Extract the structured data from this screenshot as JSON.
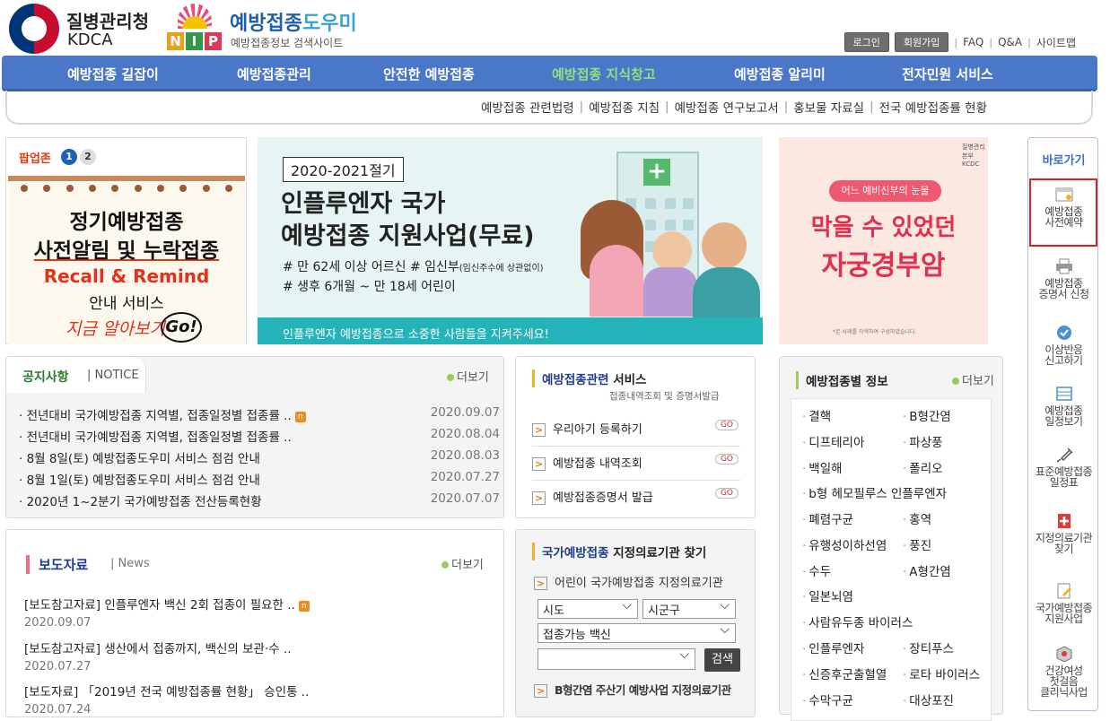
{
  "header": {
    "kdca_name": "질병관리청",
    "kdca_en": "KDCA",
    "nip_title_a": "예방접종",
    "nip_title_b": "도우미",
    "nip_sub": "예방접종정보 검색사이트",
    "nip_letters": [
      "N",
      "I",
      "P"
    ],
    "util": {
      "login": "로그인",
      "join": "회원가입",
      "faq": "FAQ",
      "qa": "Q&A",
      "sitemap": "사이트맵"
    }
  },
  "nav": {
    "items": [
      "예방접종 길잡이",
      "예방접종관리",
      "안전한 예방접종",
      "예방접종 지식창고",
      "예방접종 알리미",
      "전자민원 서비스"
    ],
    "active_index": 3,
    "sub": [
      "예방접종 관련법령",
      "예방접종 지침",
      "예방접종 연구보고서",
      "홍보물 자료실",
      "전국 예방접종률 현황"
    ]
  },
  "popup": {
    "title": "팝업존",
    "num1": "1",
    "num2": "2",
    "line1": "정기예방접종",
    "line2": "사전알림 및 누락접종",
    "line3": "Recall & Remind",
    "line4": "안내 서비스",
    "line5": "지금 알아보기",
    "go": "Go!"
  },
  "flu_banner": {
    "year": "2020-2021절기",
    "title1": "인플루엔자 국가",
    "title2": "예방접종 지원사업(무료)",
    "sub1": "# 만 62세 이상 어르신 # 임신부",
    "sub1_small": "(임신주수에 상관없이)",
    "sub2": "# 생후 6개월 ~ 만 18세 어린이",
    "footer": "인플루엔자 예방접종으로 소중한 사람들을 지켜주세요!"
  },
  "cervical_banner": {
    "logo": "질병관리본부 KCDC",
    "tag": "어느 예비신부의 눈물",
    "title1": "막을 수 있었던",
    "title2": "자궁경부암",
    "footnote": "*본 사례를 각색하여 구성하였습니다."
  },
  "quick": {
    "title": "바로가기",
    "items": [
      {
        "l1": "예방접종",
        "l2": "사전예약"
      },
      {
        "l1": "예방접종",
        "l2": "증명서 신청"
      },
      {
        "l1": "이상반응",
        "l2": "신고하기"
      },
      {
        "l1": "예방접종",
        "l2": "일정보기"
      },
      {
        "l1": "표준예방접종",
        "l2": "일정표"
      },
      {
        "l1": "지정의료기관",
        "l2": "찾기"
      },
      {
        "l1": "국가예방접종",
        "l2": "지원사업"
      },
      {
        "l1": "건강여성",
        "l2": "첫걸음",
        "l3": "클리닉사업"
      }
    ]
  },
  "notice": {
    "title": "공지사항",
    "title_en": "NOTICE",
    "more": "더보기",
    "new_badge": "n",
    "rows": [
      {
        "title": "전년대비 국가예방접종 지역별, 접종일정별 접종률 ..",
        "date": "2020.09.07",
        "new": true
      },
      {
        "title": "전년대비 국가예방접종 지역별, 접종일정별 접종률 ..",
        "date": "2020.08.04",
        "new": false
      },
      {
        "title": "8월 8일(토) 예방접종도우미 서비스 점검 안내",
        "date": "2020.08.03",
        "new": false
      },
      {
        "title": "8월 1일(토) 예방접종도우미 서비스 점검 안내",
        "date": "2020.07.27",
        "new": false
      },
      {
        "title": "2020년 1~2분기 국가예방접종 전산등록현황",
        "date": "2020.07.07",
        "new": false
      }
    ]
  },
  "press": {
    "title": "보도자료",
    "title_en": "News",
    "more": "더보기",
    "rows": [
      {
        "title": "[보도참고자료] 인플루엔자 백신 2회 접종이 필요한 ..",
        "date": "2020.09.07",
        "new": true
      },
      {
        "title": "[보도참고자료] 생산에서 접종까지, 백신의 보관·수 ..",
        "date": "2020.07.27",
        "new": false
      },
      {
        "title": "[보도자료] 「2019년 전국 예방접종률 현황」 승인통 ..",
        "date": "2020.07.24",
        "new": false
      }
    ]
  },
  "service": {
    "title_a": "예방접종관련",
    "title_b": " 서비스",
    "desc": "접종내역조회 및 증명서발급",
    "go": "GO",
    "rows": [
      "우리아기 등록하기",
      "예방접종 내역조회",
      "예방접종증명서 발급"
    ]
  },
  "clinic": {
    "title_a": "국가예방접종",
    "title_b": " 지정의료기관 찾기",
    "child": "어린이 국가예방접종 지정의료기관",
    "sido": "시도",
    "sigungu": "시군구",
    "vaccine": "접종가능 백신",
    "search": "검색",
    "hepb": "B형간염 주산기 예방사업 지정의료기관"
  },
  "vinfo": {
    "title": "예방접종별 정보",
    "more": "더보기",
    "items": [
      [
        "결핵",
        "B형간염"
      ],
      [
        "디프테리아",
        "파상풍"
      ],
      [
        "백일해",
        "폴리오"
      ],
      [
        "b형 헤모필루스 인플루엔자",
        ""
      ],
      [
        "폐렴구균",
        "홍역"
      ],
      [
        "유행성이하선염",
        "풍진"
      ],
      [
        "수두",
        "A형간염"
      ],
      [
        "일본뇌염",
        ""
      ],
      [
        "사람유두종 바이러스",
        ""
      ],
      [
        "인플루엔자",
        "장티푸스"
      ],
      [
        "신증후군출혈열",
        "로타 바이러스"
      ],
      [
        "수막구균",
        "대상포진"
      ]
    ]
  },
  "colors": {
    "nav": "#4a77c8",
    "nav_active": "#8fe37c",
    "accent_red": "#e0321c",
    "teal": "#24b3b8"
  }
}
